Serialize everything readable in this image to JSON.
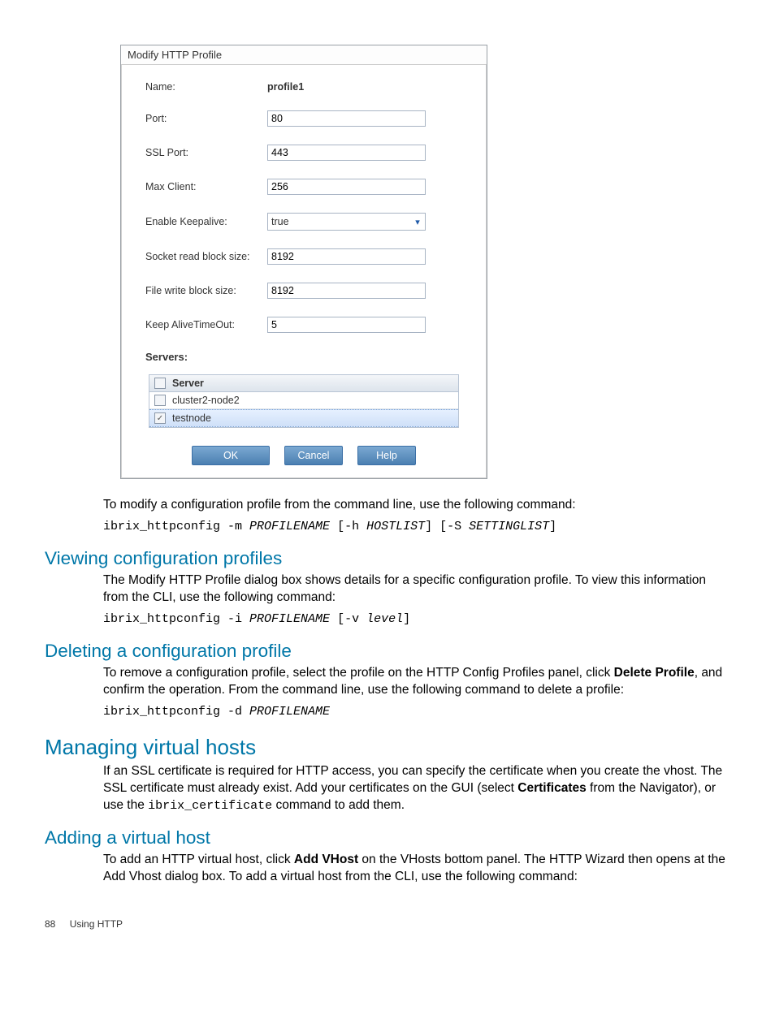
{
  "dialog": {
    "title": "Modify HTTP Profile",
    "fields": {
      "name_label": "Name:",
      "name_value": "profile1",
      "port_label": "Port:",
      "port_value": "80",
      "ssl_label": "SSL Port:",
      "ssl_value": "443",
      "max_client_label": "Max Client:",
      "max_client_value": "256",
      "keepalive_label": "Enable Keepalive:",
      "keepalive_value": "true",
      "socket_label": "Socket read block size:",
      "socket_value": "8192",
      "filewrite_label": "File write block size:",
      "filewrite_value": "8192",
      "kato_label": "Keep AliveTimeOut:",
      "kato_value": "5"
    },
    "servers_label": "Servers:",
    "server_header": "Server",
    "servers": [
      {
        "name": "cluster2-node2",
        "checked": false
      },
      {
        "name": "testnode",
        "checked": true
      }
    ],
    "buttons": {
      "ok": "OK",
      "cancel": "Cancel",
      "help": "Help"
    }
  },
  "text": {
    "modify_intro": "To modify a configuration profile from the command line, use the following command:",
    "modify_cmd_a": "ibrix_httpconfig -m ",
    "modify_cmd_b": "PROFILENAME",
    "modify_cmd_c": " [-h ",
    "modify_cmd_d": "HOSTLIST",
    "modify_cmd_e": "] [-S ",
    "modify_cmd_f": "SETTINGLIST",
    "modify_cmd_g": "]",
    "h_view": "Viewing configuration profiles",
    "view_p": "The Modify HTTP Profile dialog box shows details for a specific configuration profile. To view this information from the CLI, use the following command:",
    "view_cmd_a": "ibrix_httpconfig -i ",
    "view_cmd_b": "PROFILENAME",
    "view_cmd_c": " [-v ",
    "view_cmd_d": "level",
    "view_cmd_e": "]",
    "h_delete": "Deleting a configuration profile",
    "del_p1": "To remove a configuration profile, select the profile on the HTTP Config Profiles panel, click ",
    "del_p1b": "Delete Profile",
    "del_p2": ", and confirm the operation. From the command line, use the following command to delete a profile:",
    "del_cmd_a": "ibrix_httpconfig -d ",
    "del_cmd_b": "PROFILENAME",
    "h_vhosts": "Managing virtual hosts",
    "vh_p1": "If an SSL certificate is required for HTTP access, you can specify the certificate when you create the vhost. The SSL certificate must already exist. Add your certificates on the GUI (select ",
    "vh_p1b": "Certificates",
    "vh_p2": " from the Navigator), or use the ",
    "vh_cmd": "ibrix_certificate",
    "vh_p3": " command to add them.",
    "h_addvh": "Adding a virtual host",
    "addvh_p1": "To add an HTTP virtual host, click ",
    "addvh_p1b": "Add VHost",
    "addvh_p2": " on the VHosts bottom panel. The HTTP Wizard then opens at the Add Vhost dialog box. To add a virtual host from the CLI, use the following command:"
  },
  "footer": {
    "page": "88",
    "section": "Using HTTP"
  }
}
